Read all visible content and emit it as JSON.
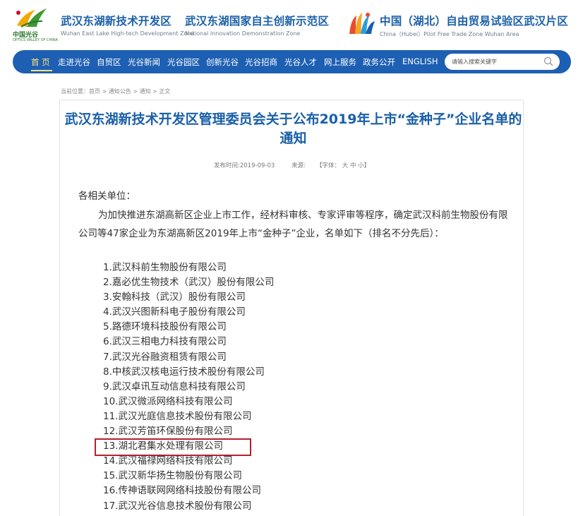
{
  "header": {
    "logo_text": "中国光谷",
    "logo_sub": "OPTICS VALLEY OF CHINA",
    "blocks": [
      {
        "title": "武汉东湖新技术开发区",
        "subtitle": "Wuhan East Lake High-tech Development Zone"
      },
      {
        "title": "武汉东湖国家自主创新示范区",
        "subtitle": "National Innovation Demonstration Zone"
      },
      {
        "title": "中国（湖北）自由贸易试验区武汉片区",
        "subtitle": "China（Hubei）Pilot Free Trade Zone Wuhan Area"
      }
    ]
  },
  "nav": {
    "items": [
      "首 页",
      "走进光谷",
      "自贸区",
      "光谷新闻",
      "光谷园区",
      "创新光谷",
      "光谷招商",
      "光谷人才",
      "网上服务",
      "政务公开",
      "ENGLISH"
    ],
    "active_index": 0,
    "search_placeholder": "请输入搜索关键字"
  },
  "breadcrumb": {
    "prefix": "当前位置：",
    "items": [
      "首页",
      "通知公告",
      "通知",
      "正文"
    ],
    "separator": " > "
  },
  "article": {
    "title": "武汉东湖新技术开发区管理委员会关于公布2019年上市“金种子”企业名单的通知",
    "published": "发布时间:2019-09-03",
    "source": "来源:",
    "font_label": "【字体：",
    "font_sizes": [
      "大",
      "中",
      "小"
    ],
    "font_end": "】",
    "salutation": "各相关单位：",
    "paragraph": "为加快推进东湖高新区企业上市工作，经材料审核、专家评审等程序，确定武汉科前生物股份有限公司等47家企业为东湖高新区2019年上市“金种子”企业，名单如下（排名不分先后）：",
    "companies": [
      "1.武汉科前生物股份有限公司",
      "2.嘉必优生物技术（武汉）股份有限公司",
      "3.安翰科技（武汉）股份有限公司",
      "4.武汉兴图新科电子股份有限公司",
      "5.路德环境科技股份有限公司",
      "6.武汉三相电力科技有限公司",
      "7.武汉光谷融资租赁有限公司",
      "8.中核武汉核电运行技术股份有限公司",
      "9.武汉卓讯互动信息科技有限公司",
      "10.武汉微派网络科技有限公司",
      "11.武汉光庭信息技术股份有限公司",
      "12.武汉芳笛环保股份有限公司",
      "13.湖北君集水处理有限公司",
      "14.武汉福禄网络科技有限公司",
      "15.武汉新华扬生物股份有限公司",
      "16.传神语联网网络科技股份有限公司",
      "17.武汉光谷信息技术股份有限公司"
    ],
    "highlighted_index": 12
  },
  "colors": {
    "brand_blue": "#1d5fb2",
    "title_blue": "#1a5fa8",
    "active_nav": "#ffe27a",
    "highlight_border": "#b3212f"
  }
}
